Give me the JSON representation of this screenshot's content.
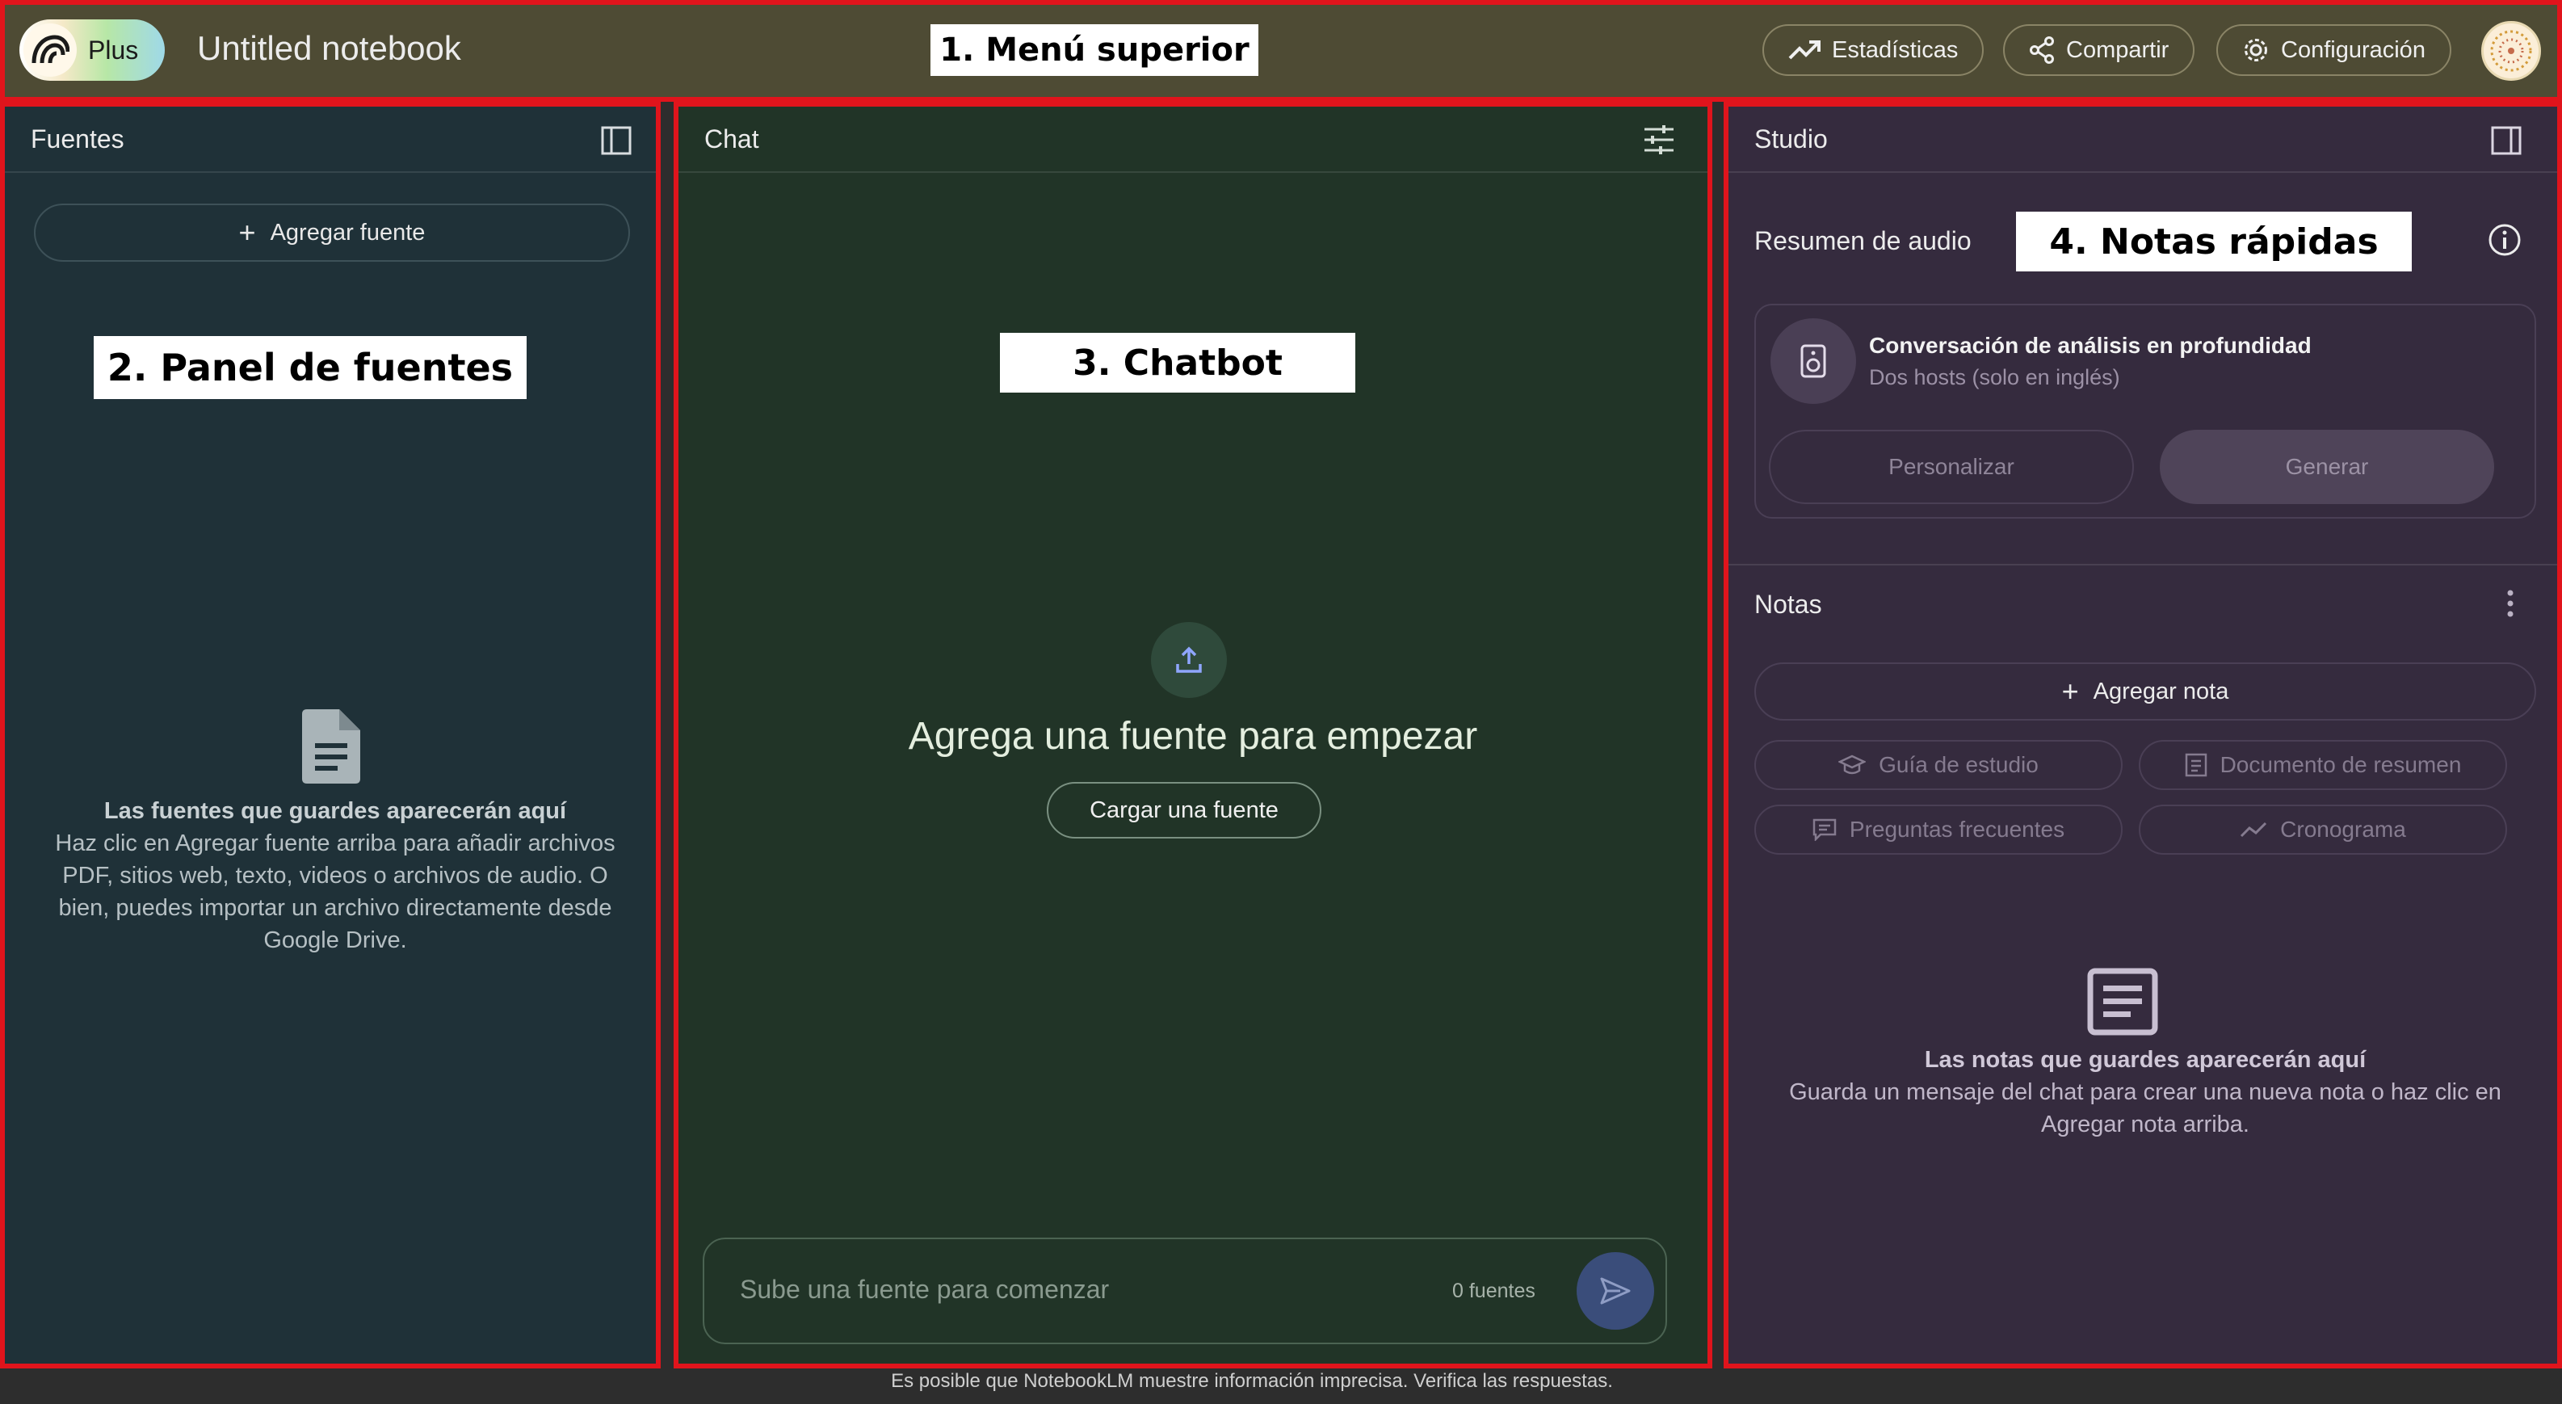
{
  "topbar": {
    "plan_badge": "Plus",
    "notebook_title": "Untitled notebook",
    "overlay_label": "1. Menú superior",
    "buttons": {
      "stats": "Estadísticas",
      "share": "Compartir",
      "settings": "Configuración"
    }
  },
  "sources_panel": {
    "title": "Fuentes",
    "add_source": "Agregar fuente",
    "overlay_label": "2. Panel de fuentes",
    "empty_title": "Las fuentes que guardes aparecerán aquí",
    "empty_body": "Haz clic en Agregar fuente arriba para añadir archivos PDF, sitios web, texto, videos o archivos de audio. O bien, puedes importar un archivo directamente desde Google Drive."
  },
  "chat_panel": {
    "title": "Chat",
    "overlay_label": "3. Chatbot",
    "headline": "Agrega una fuente para empezar",
    "upload_button": "Cargar una fuente",
    "input_placeholder": "Sube una fuente para comenzar",
    "source_count": "0 fuentes"
  },
  "studio_panel": {
    "title": "Studio",
    "audio_section_title": "Resumen de audio",
    "overlay_label": "4. Notas rápidas",
    "audio_card": {
      "title": "Conversación de análisis en profundidad",
      "subtitle": "Dos hosts (solo en inglés)",
      "customize": "Personalizar",
      "generate": "Generar"
    },
    "notes_title": "Notas",
    "add_note": "Agregar nota",
    "chips": [
      "Guía de estudio",
      "Documento de resumen",
      "Preguntas frecuentes",
      "Cronograma"
    ],
    "empty_title": "Las notas que guardes aparecerán aquí",
    "empty_body": "Guarda un mensaje del chat para crear una nueva nota o haz clic en Agregar nota arriba."
  },
  "footer": "Es posible que NotebookLM muestre información imprecisa. Verifica las respuestas.",
  "colors": {
    "annotation_border": "#e0141c",
    "topbar_bg": "#4e4b34",
    "sources_bg": "#1f3138",
    "chat_bg": "#213427",
    "studio_bg": "#352b3e"
  }
}
